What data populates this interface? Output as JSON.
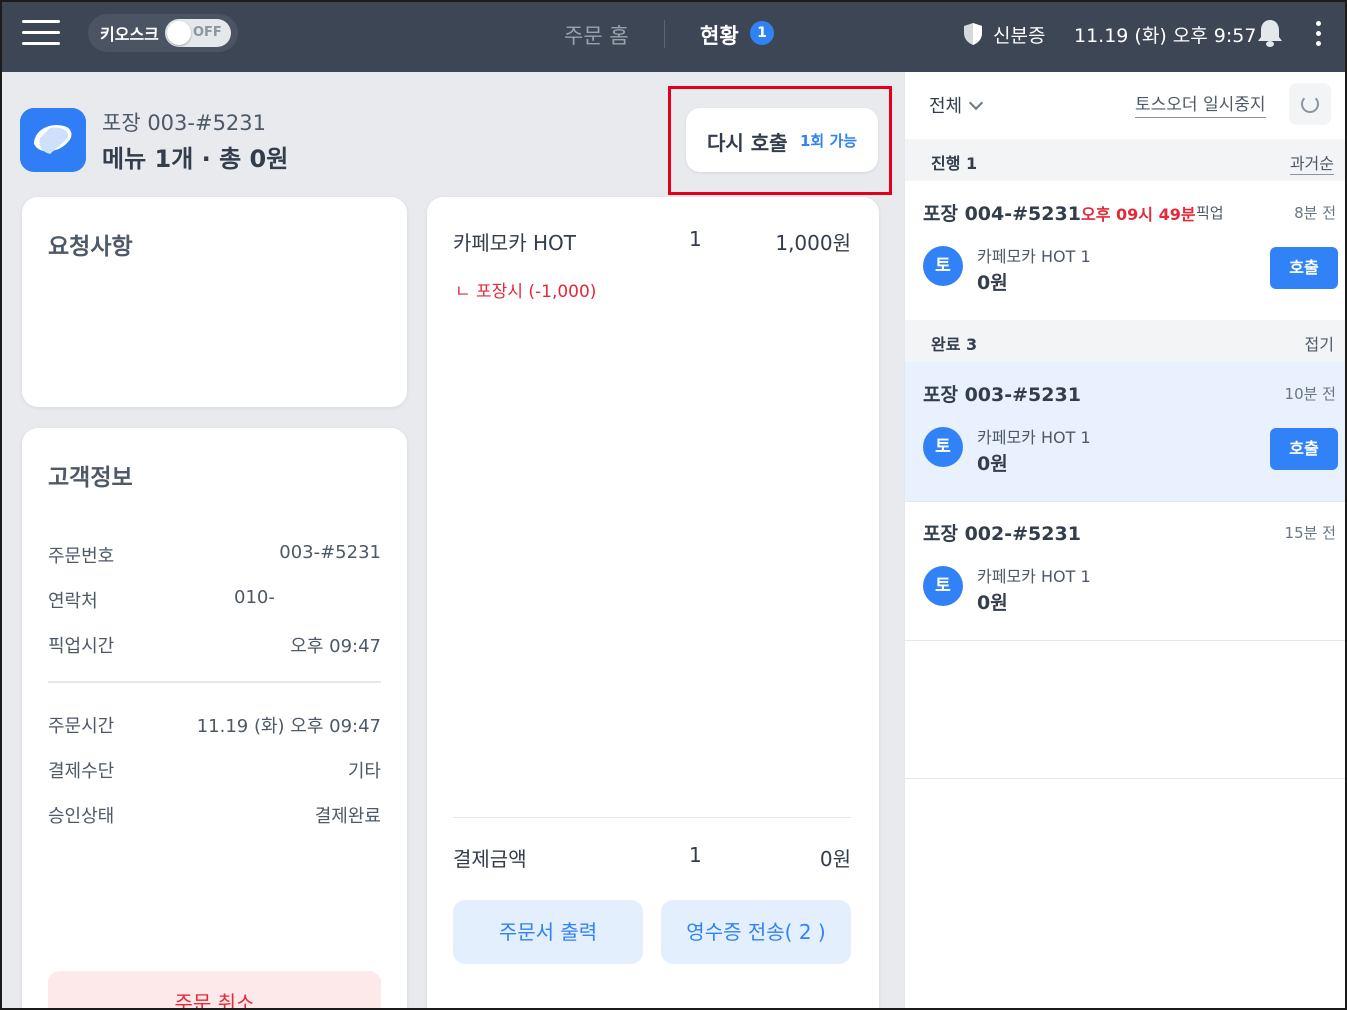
{
  "topbar": {
    "kiosk_label": "키오스크",
    "kiosk_toggle": "OFF",
    "nav_home": "주문 홈",
    "nav_status": "현황",
    "nav_status_badge": "1",
    "id_label": "신분증",
    "datetime": "11.19 (화) 오후 9:57"
  },
  "order": {
    "head": "포장 003-#5231",
    "summary": "메뉴 1개 · 총 0원",
    "recall_label": "다시 호출",
    "recall_sub": "1회 가능"
  },
  "request": {
    "title": "요청사항"
  },
  "customer": {
    "title": "고객정보",
    "rows": [
      {
        "label": "주문번호",
        "value": "003-#5231"
      },
      {
        "label": "연락처",
        "value": "010-"
      },
      {
        "label": "픽업시간",
        "value": "오후 09:47"
      },
      {
        "label": "주문시간",
        "value": "11.19 (화) 오후 09:47"
      },
      {
        "label": "결제수단",
        "value": "기타"
      },
      {
        "label": "승인상태",
        "value": "결제완료"
      }
    ],
    "cancel_label": "주문 취소"
  },
  "menu": {
    "item_name": "카페모카 HOT",
    "item_qty": "1",
    "item_price": "1,000원",
    "item_option": "ㄴ 포장시 (-1,000)",
    "pay_label": "결제금액",
    "pay_qty": "1",
    "pay_total": "0원",
    "print_label": "주문서 출력",
    "receipt_label": "영수증 전송( 2 )"
  },
  "panel": {
    "filter": "전체",
    "pause_label": "토스오더 일시중지",
    "in_progress_title": "진행 1",
    "in_progress_sort": "과거순",
    "done_title": "완료 3",
    "done_toggle": "접기",
    "orders": [
      {
        "title": "포장 004-#5231",
        "time": "오후 09시 49분",
        "pick": "픽업",
        "ago": "8분 전",
        "avatar": "토",
        "menu": "카페모카 HOT 1",
        "price": "0원",
        "call": "호출"
      },
      {
        "title": "포장 003-#5231",
        "ago": "10분 전",
        "avatar": "토",
        "menu": "카페모카 HOT 1",
        "price": "0원",
        "call": "호출"
      },
      {
        "title": "포장 002-#5231",
        "ago": "15분 전",
        "avatar": "토",
        "menu": "카페모카 HOT 1",
        "price": "0원"
      }
    ]
  },
  "colors": {
    "topbar": "#3d4654",
    "accent": "#3182f6",
    "danger": "#e42939",
    "highlight_box": "#e3001b"
  }
}
